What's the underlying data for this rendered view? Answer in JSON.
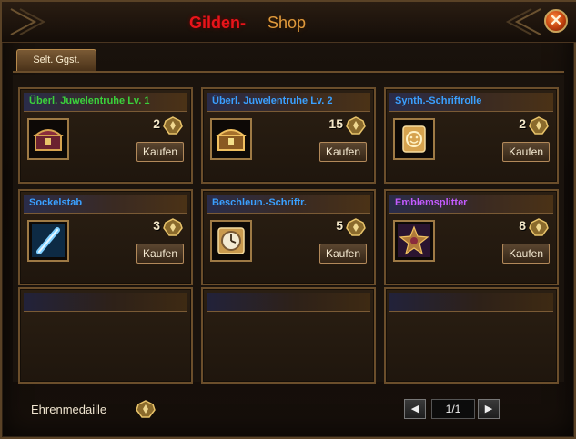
{
  "window": {
    "title_part1": "Gilden-",
    "title_part2": "Shop",
    "close_label": "✕"
  },
  "tabs": [
    {
      "label": "Selt. Ggst.",
      "active": true
    }
  ],
  "items": [
    {
      "name": "Überl. Juwelentruhe Lv. 1",
      "name_color": "#3bd13b",
      "price": "2",
      "buy_label": "Kaufen",
      "icon": "jewel-chest-icon"
    },
    {
      "name": "Überl. Juwelentruhe Lv. 2",
      "name_color": "#3aa0ff",
      "price": "15",
      "buy_label": "Kaufen",
      "icon": "jewel-chest-icon"
    },
    {
      "name": "Synth.-Schriftrolle",
      "name_color": "#3aa0ff",
      "price": "2",
      "buy_label": "Kaufen",
      "icon": "smiley-scroll-icon"
    },
    {
      "name": "Sockelstab",
      "name_color": "#3aa0ff",
      "price": "3",
      "buy_label": "Kaufen",
      "icon": "socket-rod-icon"
    },
    {
      "name": "Beschleun.-Schriftr.",
      "name_color": "#3aa0ff",
      "price": "5",
      "buy_label": "Kaufen",
      "icon": "clock-scroll-icon"
    },
    {
      "name": "Emblemsplitter",
      "name_color": "#c45bff",
      "price": "8",
      "buy_label": "Kaufen",
      "icon": "emblem-shard-icon"
    }
  ],
  "empty_slots": 3,
  "footer": {
    "currency_label": "Ehrenmedaille",
    "currency_icon": "honor-medal-icon",
    "page": "1/1",
    "prev_label": "◀",
    "next_label": "▶"
  },
  "colors": {
    "gold_border": "#9e7a45",
    "title_red": "#e8141a",
    "title_orange": "#e09a3c"
  }
}
